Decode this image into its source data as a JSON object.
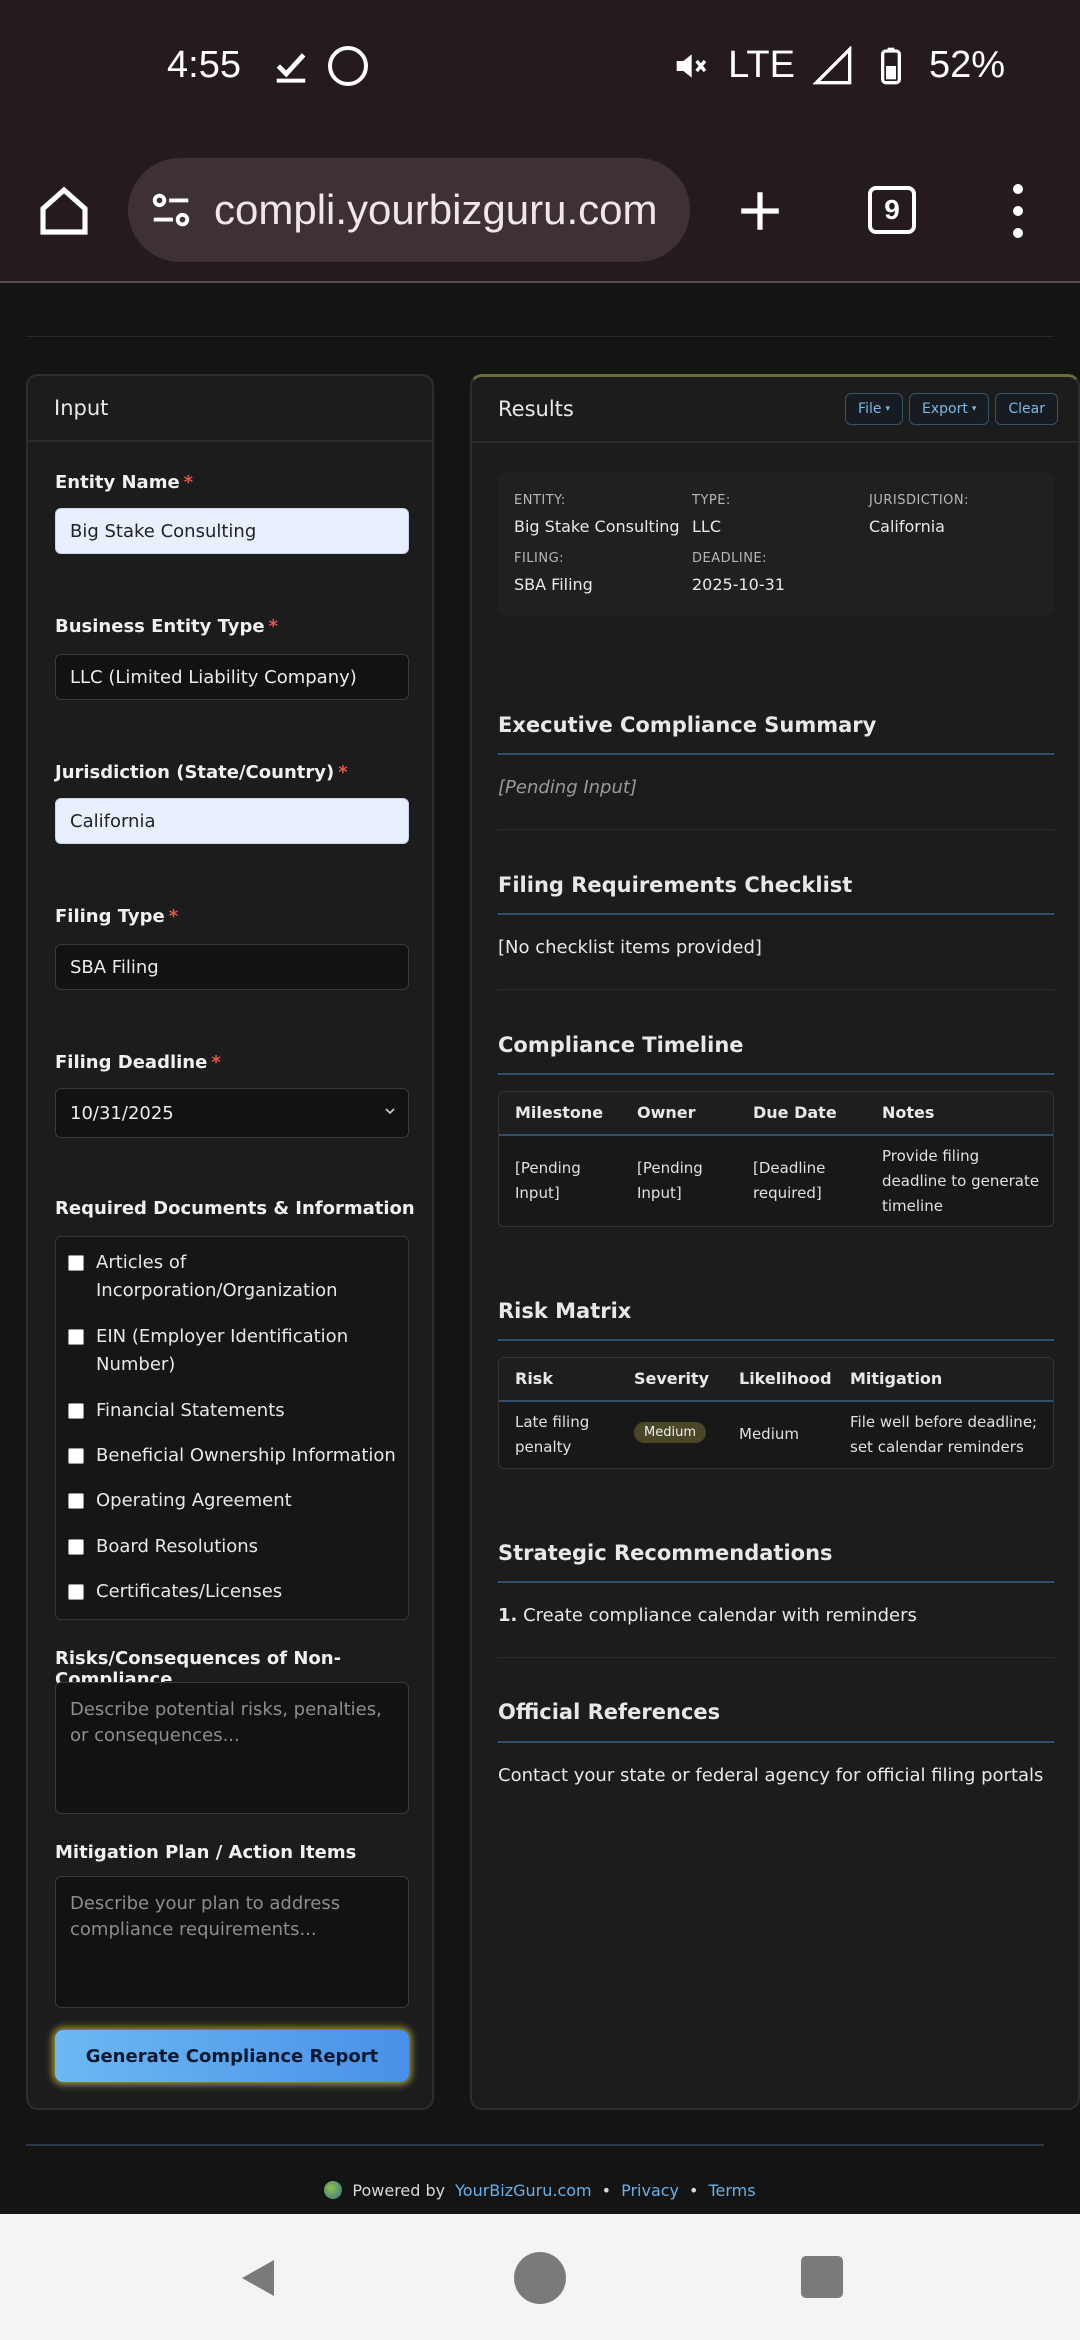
{
  "status_bar": {
    "time": "4:55",
    "network": "LTE",
    "battery": "52%",
    "icons": [
      "download-done-icon",
      "globe-icon",
      "mute-icon",
      "signal-icon",
      "battery-icon"
    ]
  },
  "browser": {
    "url": "compli.yourbizguru.com",
    "tab_count": "9"
  },
  "input_panel": {
    "title": "Input",
    "entity_name": {
      "label": "Entity Name",
      "value": "Big Stake Consulting"
    },
    "entity_type": {
      "label": "Business Entity Type",
      "value": "LLC (Limited Liability Company)"
    },
    "jurisdiction": {
      "label": "Jurisdiction (State/Country)",
      "value": "California"
    },
    "filing_type": {
      "label": "Filing Type",
      "value": "SBA Filing"
    },
    "filing_deadline": {
      "label": "Filing Deadline",
      "value": "10/31/2025"
    },
    "required_mark": "*",
    "documents": {
      "label": "Required Documents & Information",
      "items": [
        "Articles of Incorporation/Organization",
        "EIN (Employer Identification Number)",
        "Financial Statements",
        "Beneficial Ownership Information",
        "Operating Agreement",
        "Board Resolutions",
        "Certificates/Licenses"
      ]
    },
    "risks": {
      "label": "Risks/Consequences of Non-Compliance",
      "placeholder": "Describe potential risks, penalties, or consequences..."
    },
    "mitigation": {
      "label": "Mitigation Plan / Action Items",
      "placeholder": "Describe your plan to address compliance requirements..."
    },
    "generate_button": "Generate Compliance Report"
  },
  "results_panel": {
    "title": "Results",
    "buttons": {
      "file": "File",
      "export": "Export",
      "clear": "Clear"
    },
    "meta": {
      "entity_key": "ENTITY:",
      "entity_value": "Big Stake Consulting",
      "type_key": "TYPE:",
      "type_value": "LLC",
      "jurisdiction_key": "JURISDICTION:",
      "jurisdiction_value": "California",
      "filing_key": "FILING:",
      "filing_value": "SBA Filing",
      "deadline_key": "DEADLINE:",
      "deadline_value": "2025-10-31"
    },
    "summary": {
      "title": "Executive Compliance Summary",
      "text": "[Pending Input]"
    },
    "checklist": {
      "title": "Filing Requirements Checklist",
      "text": "[No checklist items provided]"
    },
    "timeline": {
      "title": "Compliance Timeline",
      "headers": [
        "Milestone",
        "Owner",
        "Due Date",
        "Notes"
      ],
      "row": [
        "[Pending Input]",
        "[Pending Input]",
        "[Deadline required]",
        "Provide filing deadline to generate timeline"
      ]
    },
    "risk_matrix": {
      "title": "Risk Matrix",
      "headers": [
        "Risk",
        "Severity",
        "Likelihood",
        "Mitigation"
      ],
      "row": [
        "Late filing penalty",
        "Medium",
        "Medium",
        "File well before deadline; set calendar reminders"
      ]
    },
    "recommendations": {
      "title": "Strategic Recommendations",
      "number": "1.",
      "text": "Create compliance calendar with reminders"
    },
    "references": {
      "title": "Official References",
      "text": "Contact your state or federal agency for official filing portals"
    }
  },
  "footer": {
    "powered_by": "Powered by",
    "brand_link": "YourBizGuru.com",
    "separator": "•",
    "privacy": "Privacy",
    "terms": "Terms"
  }
}
